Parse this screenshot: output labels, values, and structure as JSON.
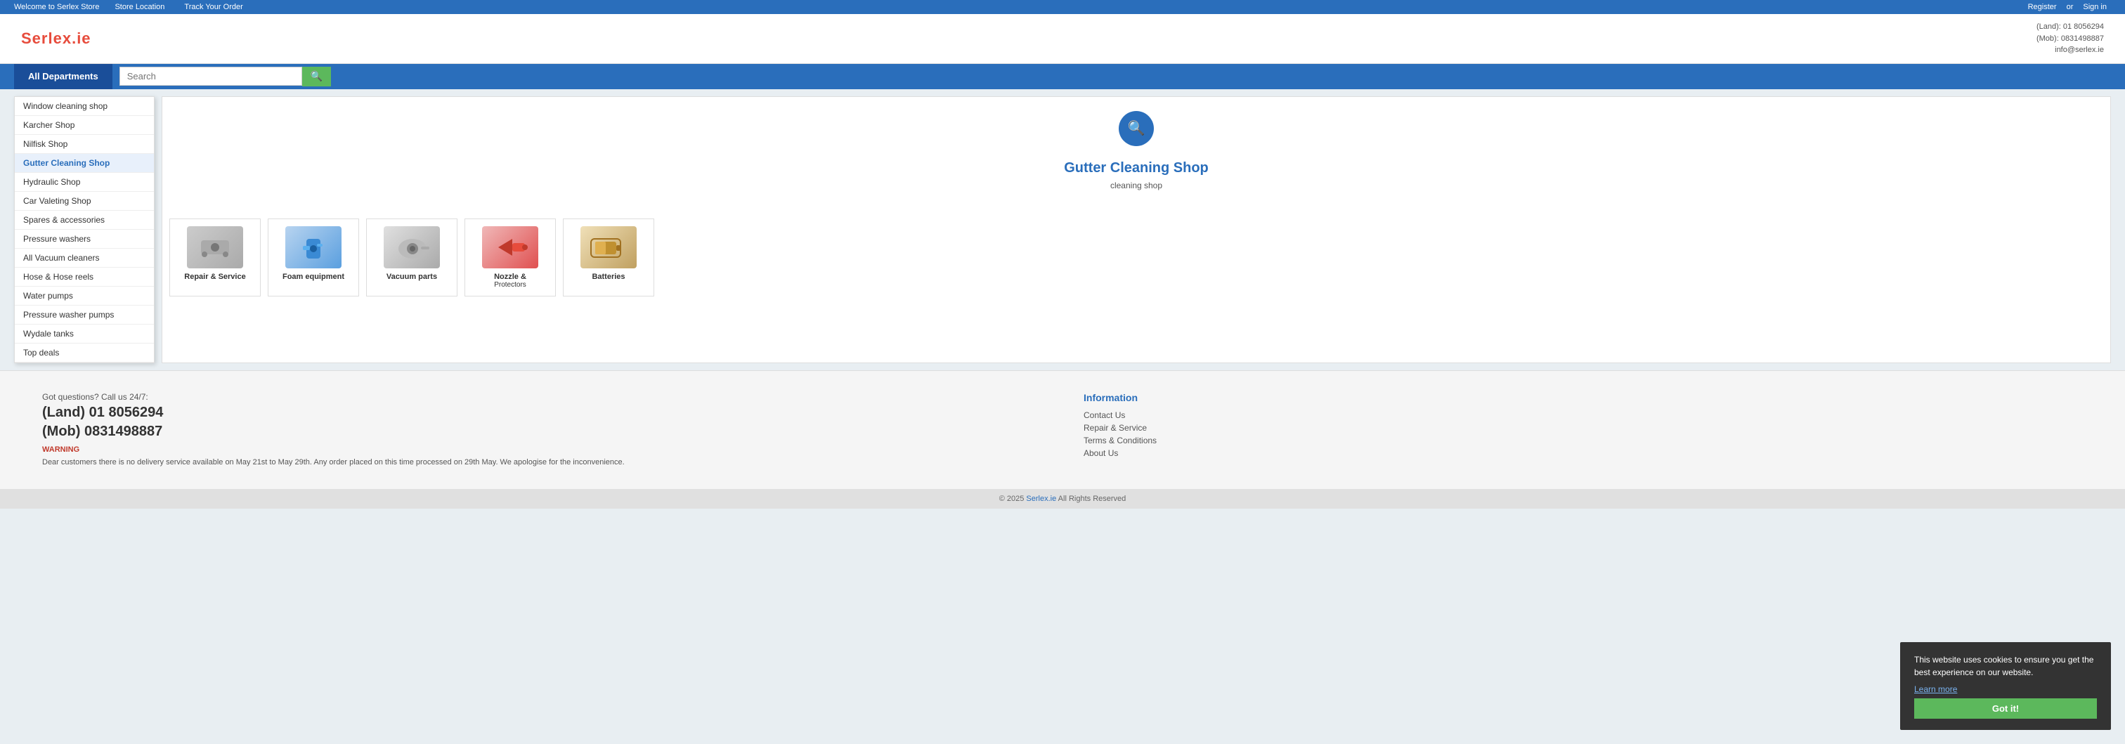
{
  "topbar": {
    "welcome": "Welcome to Serlex Store",
    "store_location": "Store Location",
    "track_order": "Track Your Order",
    "register": "Register",
    "or": "or",
    "sign_in": "Sign in"
  },
  "header": {
    "logo_main": "Serlex",
    "logo_dot": ".",
    "logo_ext": "ie",
    "contact_land": "(Land): 01 8056294",
    "contact_mob": "(Mob): 0831498887",
    "contact_email": "info@serlex.ie"
  },
  "nav": {
    "all_departments": "All Departments",
    "search_placeholder": "Search"
  },
  "menu": {
    "items": [
      {
        "label": "Window cleaning shop",
        "active": false
      },
      {
        "label": "Karcher Shop",
        "active": false
      },
      {
        "label": "Nilfisk Shop",
        "active": false
      },
      {
        "label": "Gutter Cleaning Shop",
        "active": true
      },
      {
        "label": "Hydraulic Shop",
        "active": false
      },
      {
        "label": "Car Valeting Shop",
        "active": false
      },
      {
        "label": "Spares & accessories",
        "active": false
      },
      {
        "label": "Pressure washers",
        "active": false
      },
      {
        "label": "All Vacuum cleaners",
        "active": false
      },
      {
        "label": "Hose & Hose reels",
        "active": false
      },
      {
        "label": "Water pumps",
        "active": false
      },
      {
        "label": "Pressure washer pumps",
        "active": false
      },
      {
        "label": "Wydale tanks",
        "active": false
      },
      {
        "label": "Top deals",
        "active": false
      }
    ]
  },
  "section": {
    "title": "Gutter Cleaning Shop",
    "subtitle": "cleaning shop",
    "search_icon": "🔍"
  },
  "products": [
    {
      "label": "Repair & Service",
      "icon": "🔧",
      "color": "#ccc"
    },
    {
      "label": "Foam equipment",
      "icon": "💧",
      "color": "#b8d4f0"
    },
    {
      "label": "Vacuum parts",
      "icon": "⚙️",
      "color": "#e0e0e0"
    },
    {
      "label": "Nozzle &\nProtectors",
      "icon": "🔴",
      "color": "#f0b8b8"
    },
    {
      "label": "Batteries",
      "icon": "🔋",
      "color": "#f0e0b8"
    }
  ],
  "footer": {
    "contact_intro": "Got questions? Call us 24/7:",
    "contact_land": "(Land) 01 8056294",
    "contact_mob": "(Mob) 0831498887",
    "warning_title": "WARNING",
    "warning_text": "Dear customers there is no delivery service available on May 21st to May 29th. Any order placed on this time processed on 29th May. We apologise for the inconvenience.",
    "info_title": "Information",
    "links": [
      "Contact Us",
      "Repair & Service",
      "Terms & Conditions",
      "About Us"
    ]
  },
  "footer_bottom": {
    "copy": "© 2025",
    "brand": "Serlex.ie",
    "rights": " All Rights Reserved"
  },
  "cookie": {
    "message": "This website uses cookies to ensure you get the best experience on our website.",
    "learn_more": "Learn more",
    "accept": "Got it!"
  }
}
